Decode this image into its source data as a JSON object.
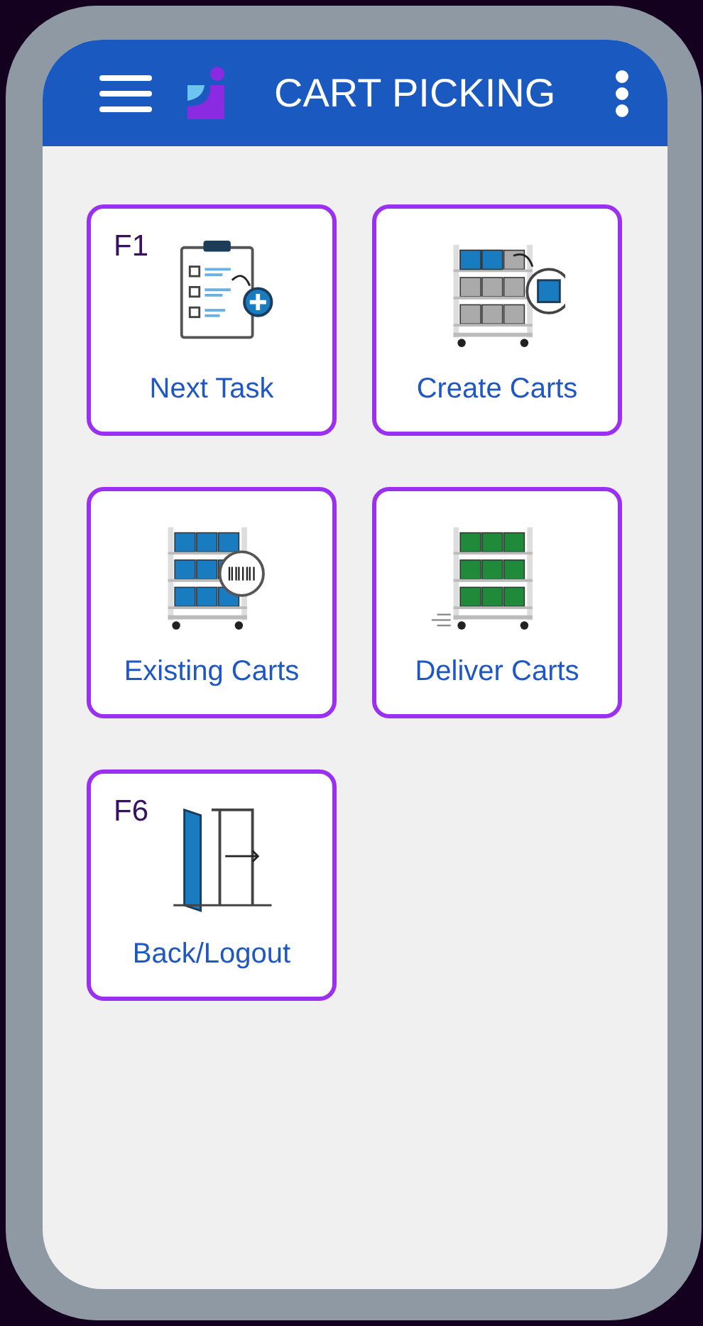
{
  "header": {
    "title": "CART PICKING"
  },
  "tiles": [
    {
      "label": "Next Task",
      "hotkey": "F1",
      "kind": "clipboard"
    },
    {
      "label": "Create Carts",
      "kind": "cart-create"
    },
    {
      "label": "Existing Carts",
      "kind": "cart-scan"
    },
    {
      "label": "Deliver Carts",
      "kind": "cart-deliver"
    },
    {
      "label": "Back/Logout",
      "hotkey": "F6",
      "kind": "exit"
    }
  ]
}
